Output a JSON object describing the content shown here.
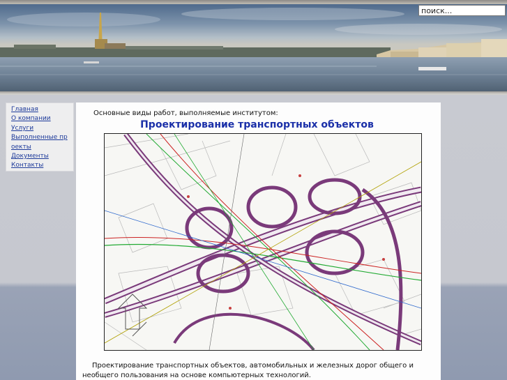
{
  "header": {
    "search": {
      "placeholder": "поиск..."
    }
  },
  "sidebar": {
    "items": [
      {
        "label": "Главная"
      },
      {
        "label": "О компании"
      },
      {
        "label": "Услуги"
      },
      {
        "label": "Выполненные проекты"
      },
      {
        "label": "Документы"
      },
      {
        "label": "Контакты"
      }
    ]
  },
  "main": {
    "intro": "Основные виды работ, выполняемые институтом:",
    "title": "Проектирование транспортных объектов",
    "description": "Проектирование транспортных объектов, автомобильных и железных дорог общего и необщего пользования на основе компьютерных технологий."
  },
  "colors": {
    "title": "#1a2fa8",
    "link": "#1d3a9a",
    "map_road_outline": "#7a3a7a",
    "map_track_red": "#cc2222",
    "map_track_green": "#22aa33"
  }
}
